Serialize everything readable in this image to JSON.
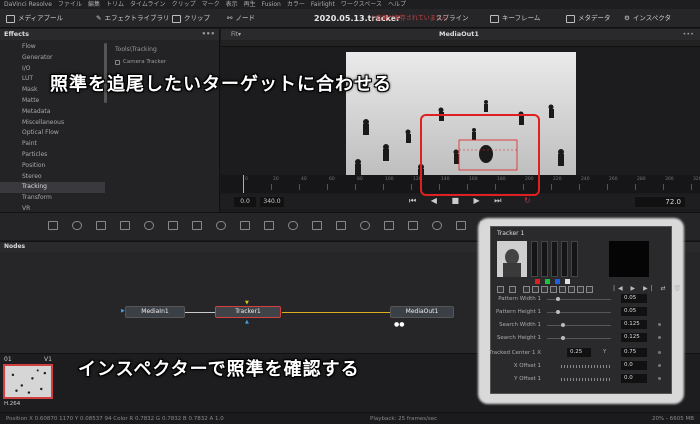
{
  "menubar": {
    "items": [
      "DaVinci Resolve",
      "ファイル",
      "編集",
      "トリム",
      "タイムライン",
      "クリップ",
      "マーク",
      "表示",
      "再生",
      "Fusion",
      "カラー",
      "Fairlight",
      "ワークスペース",
      "ヘルプ"
    ]
  },
  "toolbar": {
    "media_pool": "メディアプール",
    "effects_library": "エフェクトライブラリ",
    "clips": "クリップ",
    "nodes": "ノード",
    "project_title": "2020.05.13.tracker",
    "unsaved_warning": "| 変更が保存されていません",
    "spline": "スプライン",
    "keyframes": "キーフレーム",
    "metadata": "メタデータ",
    "inspector": "インスペクタ"
  },
  "effects": {
    "title": "Effects",
    "items": [
      "Flow",
      "Generator",
      "I/O",
      "LUT",
      "Mask",
      "Matte",
      "Metadata",
      "Miscellaneous",
      "Optical Flow",
      "Paint",
      "Particles",
      "Position",
      "Stereo",
      "Tracking",
      "Transform",
      "VR"
    ],
    "selected_index": 13,
    "subpath": "Tools\\Tracking",
    "subitem": "Camera Tracker"
  },
  "viewer": {
    "fit": "Fit▾",
    "name": "MediaOut1",
    "timeline_labels": [
      "0",
      "20",
      "40",
      "60",
      "80",
      "100",
      "120",
      "140",
      "160",
      "180",
      "200",
      "220",
      "240",
      "260",
      "280",
      "300",
      "320"
    ],
    "tc_start": "0.0",
    "tc_end": "340.0",
    "transport": "⏮ ◀ ■ ▶ ⏭",
    "loop": "↻",
    "frame": "72.0"
  },
  "nodes": {
    "title": "Nodes",
    "media_in": "MediaIn1",
    "tracker": "Tracker1",
    "media_out": "MediaOut1"
  },
  "clips": {
    "num": "01",
    "track": "V1",
    "codec": "H.264"
  },
  "status": {
    "left": "Position  X  0.60870   1170   Y  0.08537   94    Color  R  0.7832    G  0.7832    B  0.7832    A  1.0",
    "mid": "Playback: 25 frames/sec",
    "right": "20% - 6605 MB"
  },
  "inspector": {
    "title": "Tracker 1",
    "params": [
      {
        "label": "Pattern Width 1",
        "value": "0.05",
        "knob": 0.05
      },
      {
        "label": "Pattern Height 1",
        "value": "0.05",
        "knob": 0.05
      },
      {
        "label": "Search Width 1",
        "value": "0.125",
        "knob": 0.125
      },
      {
        "label": "Search Height 1",
        "value": "0.125",
        "knob": 0.125
      }
    ],
    "center_label": "Tracked Center 1   X",
    "center_x": "0.25",
    "center_y_label": "Y",
    "center_y": "0.75",
    "x_offset_label": "X Offset 1",
    "x_offset": "0.0",
    "y_offset_label": "Y Offset 1",
    "y_offset": "0.0"
  },
  "captions": {
    "top": "照準を追尾したいターゲットに合わせる",
    "bottom": "インスペクターで照準を確認する"
  },
  "colors": {
    "accent_red": "#e02020",
    "playhead": "#e0b020"
  }
}
